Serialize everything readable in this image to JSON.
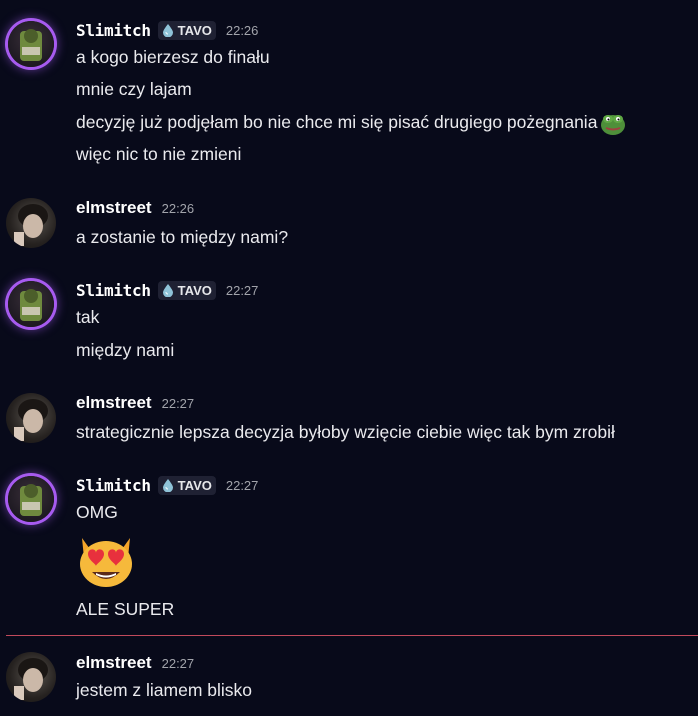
{
  "chat": {
    "users": {
      "slimitch": {
        "name": "Slimitch",
        "tag": "TAVO"
      },
      "elmstreet": {
        "name": "elmstreet"
      }
    },
    "groups": [
      {
        "time": "22:26",
        "lines": [
          "a kogo bierzesz do finału",
          "mnie czy lajam",
          "decyzję już podjęłam bo nie chce mi się pisać drugiego pożegnania",
          "więc nic to nie zmieni"
        ]
      },
      {
        "time": "22:26",
        "lines": [
          "a zostanie to między nami?"
        ]
      },
      {
        "time": "22:27",
        "lines": [
          "tak",
          "między nami"
        ]
      },
      {
        "time": "22:27",
        "lines": [
          "strategicznie lepsza decyzja byłoby wzięcie ciebie więc tak bym zrobił"
        ]
      },
      {
        "time": "22:27",
        "lines": [
          "OMG",
          "ALE SUPER"
        ]
      },
      {
        "time": "22:27",
        "lines": [
          "jestem z liamem blisko"
        ]
      }
    ]
  },
  "icons": {
    "tag_icon": "water-drop-icon",
    "inline_emoji": "pepe-frog-emoji",
    "big_emoji": "heart-eyes-cat-emoji"
  },
  "colors": {
    "background": "#080a1a",
    "avatar_ring": "#a75bf0",
    "new_messages_divider": "#c14a5c"
  }
}
